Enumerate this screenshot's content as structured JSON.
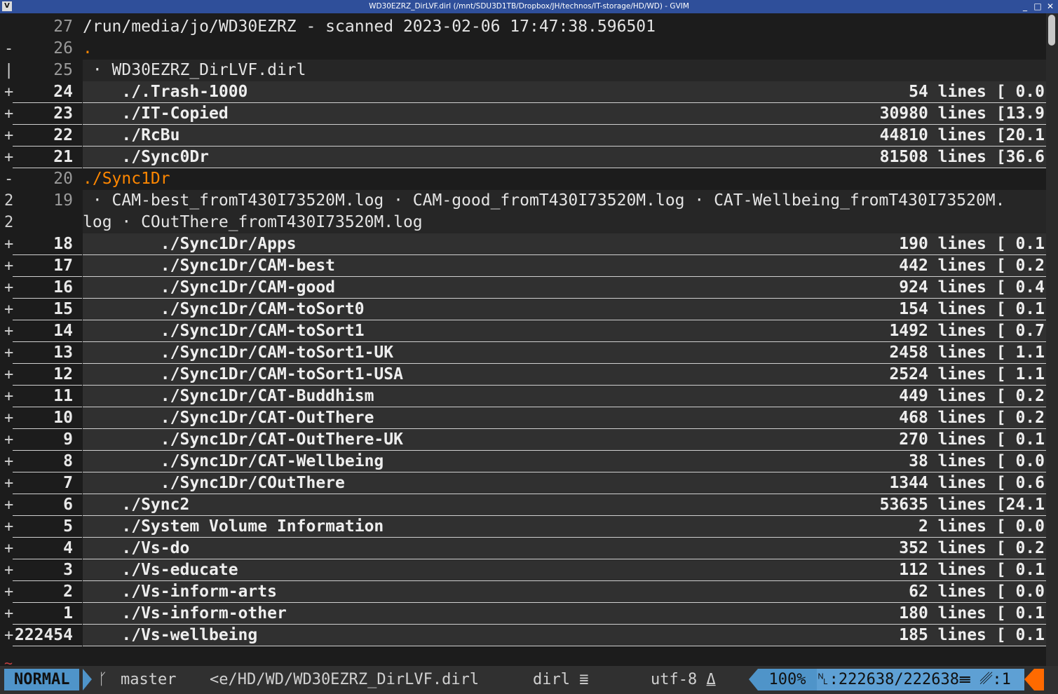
{
  "window": {
    "title": "WD30EZRZ_DirLVF.dirl (/mnt/SDU3D1TB/Dropbox/JH/technos/IT-storage/HD/WD) - GVIM",
    "app_icon": "gvim-icon",
    "buttons": [
      "_",
      "□",
      "✕"
    ]
  },
  "lines": [
    {
      "sign": "",
      "num": "27",
      "text": "/run/media/jo/WD30EZRZ - scanned 2023-02-06 17:47:38.596501",
      "kind": "plain"
    },
    {
      "sign": "-",
      "num": "26",
      "text": ".",
      "kind": "plain",
      "orange": true
    },
    {
      "sign": "|",
      "num": "25",
      "text": " · WD30EZRZ_DirLVF.dirl",
      "kind": "shaded"
    },
    {
      "sign": "+",
      "num": "24",
      "label": "    ./.Trash-1000",
      "count": "54 lines [ 0.0",
      "kind": "fold"
    },
    {
      "sign": "+",
      "num": "23",
      "label": "    ./IT-Copied",
      "count": "30980 lines [13.9",
      "kind": "fold"
    },
    {
      "sign": "+",
      "num": "22",
      "label": "    ./RcBu",
      "count": "44810 lines [20.1",
      "kind": "fold"
    },
    {
      "sign": "+",
      "num": "21",
      "label": "    ./Sync0Dr",
      "count": "81508 lines [36.6",
      "kind": "fold"
    },
    {
      "sign": "-",
      "num": "20",
      "text": "./Sync1Dr",
      "kind": "plain",
      "orange": true
    },
    {
      "sign": "2",
      "num": "19",
      "text": " · CAM-best_fromT430I73520M.log · CAM-good_fromT430I73520M.log · CAT-Wellbeing_fromT430I73520M.",
      "kind": "shaded"
    },
    {
      "sign": "2",
      "num": "",
      "text": "log · COutThere_fromT430I73520M.log",
      "kind": "shaded"
    },
    {
      "sign": "+",
      "num": "18",
      "label": "        ./Sync1Dr/Apps",
      "count": "190 lines [ 0.1",
      "kind": "fold"
    },
    {
      "sign": "+",
      "num": "17",
      "label": "        ./Sync1Dr/CAM-best",
      "count": "442 lines [ 0.2",
      "kind": "fold"
    },
    {
      "sign": "+",
      "num": "16",
      "label": "        ./Sync1Dr/CAM-good",
      "count": "924 lines [ 0.4",
      "kind": "fold"
    },
    {
      "sign": "+",
      "num": "15",
      "label": "        ./Sync1Dr/CAM-toSort0",
      "count": "154 lines [ 0.1",
      "kind": "fold"
    },
    {
      "sign": "+",
      "num": "14",
      "label": "        ./Sync1Dr/CAM-toSort1",
      "count": "1492 lines [ 0.7",
      "kind": "fold"
    },
    {
      "sign": "+",
      "num": "13",
      "label": "        ./Sync1Dr/CAM-toSort1-UK",
      "count": "2458 lines [ 1.1",
      "kind": "fold"
    },
    {
      "sign": "+",
      "num": "12",
      "label": "        ./Sync1Dr/CAM-toSort1-USA",
      "count": "2524 lines [ 1.1",
      "kind": "fold"
    },
    {
      "sign": "+",
      "num": "11",
      "label": "        ./Sync1Dr/CAT-Buddhism",
      "count": "449 lines [ 0.2",
      "kind": "fold"
    },
    {
      "sign": "+",
      "num": "10",
      "label": "        ./Sync1Dr/CAT-OutThere",
      "count": "468 lines [ 0.2",
      "kind": "fold"
    },
    {
      "sign": "+",
      "num": "9",
      "label": "        ./Sync1Dr/CAT-OutThere-UK",
      "count": "270 lines [ 0.1",
      "kind": "fold"
    },
    {
      "sign": "+",
      "num": "8",
      "label": "        ./Sync1Dr/CAT-Wellbeing",
      "count": "38 lines [ 0.0",
      "kind": "fold"
    },
    {
      "sign": "+",
      "num": "7",
      "label": "        ./Sync1Dr/COutThere",
      "count": "1344 lines [ 0.6",
      "kind": "fold"
    },
    {
      "sign": "+",
      "num": "6",
      "label": "    ./Sync2",
      "count": "53635 lines [24.1",
      "kind": "fold"
    },
    {
      "sign": "+",
      "num": "5",
      "label": "    ./System Volume Information",
      "count": "2 lines [ 0.0",
      "kind": "fold"
    },
    {
      "sign": "+",
      "num": "4",
      "label": "    ./Vs-do",
      "count": "352 lines [ 0.2",
      "kind": "fold"
    },
    {
      "sign": "+",
      "num": "3",
      "label": "    ./Vs-educate",
      "count": "112 lines [ 0.1",
      "kind": "fold"
    },
    {
      "sign": "+",
      "num": "2",
      "label": "    ./Vs-inform-arts",
      "count": "62 lines [ 0.0",
      "kind": "fold"
    },
    {
      "sign": "+",
      "num": "1",
      "label": "    ./Vs-inform-other",
      "count": "180 lines [ 0.1",
      "kind": "fold"
    },
    {
      "sign": "+",
      "num": "222454",
      "label": "    ./Vs-wellbeing",
      "count": "185 lines [ 0.1",
      "kind": "fold"
    }
  ],
  "tilde": "~",
  "status": {
    "mode": "NORMAL",
    "branch_icon": "git-branch-icon",
    "branch_glyph": "ᚴ",
    "branch": "master",
    "file": "<e/HD/WD/WD30EZRZ_DirLVF.dirl",
    "filetype": "dirl ≣",
    "encoding": "utf-8 ⍙",
    "percent": "100%",
    "position": "␤:222638/222638☰ ␥:1"
  },
  "colors": {
    "accent": "#4f94c9",
    "orange": "#ff8700",
    "end_marker": "#ff6a00",
    "titlebar": "#2f4f9a"
  }
}
